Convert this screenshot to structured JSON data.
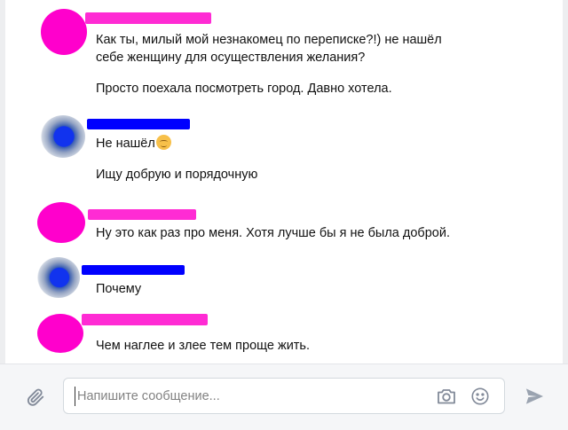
{
  "messages": [
    {
      "sender": "pink",
      "lines": [
        "Как ты, милый мой незнакомец по переписке?!) не нашёл",
        "себе женщину для осуществления желания?",
        "Просто поехала посмотреть город. Давно хотела."
      ]
    },
    {
      "sender": "blue",
      "lines": [
        "Не нашёл",
        "Ищу добрую и порядочную"
      ],
      "emoji": "relieved-face"
    },
    {
      "sender": "pink",
      "lines": [
        "Ну это как раз про меня. Хотя лучше бы я не была доброй."
      ]
    },
    {
      "sender": "blue",
      "lines": [
        "Почему"
      ]
    },
    {
      "sender": "pink",
      "lines": [
        "Чем наглее и злее тем проще жить."
      ]
    }
  ],
  "composer": {
    "placeholder": "Напишите сообщение...",
    "icons": [
      "paperclip-icon",
      "camera-icon",
      "smile-icon",
      "send-icon"
    ]
  },
  "colors": {
    "pink_redaction": "#ff00cc",
    "blue_redaction": "#0000ff",
    "icon_gray": "#828a99"
  }
}
